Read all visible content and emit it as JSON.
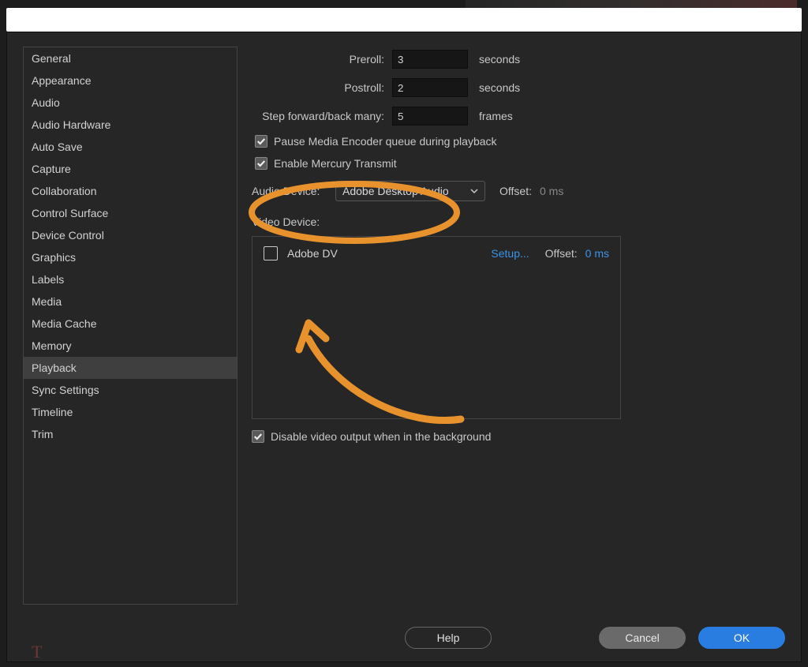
{
  "sidebar": {
    "items": [
      "General",
      "Appearance",
      "Audio",
      "Audio Hardware",
      "Auto Save",
      "Capture",
      "Collaboration",
      "Control Surface",
      "Device Control",
      "Graphics",
      "Labels",
      "Media",
      "Media Cache",
      "Memory",
      "Playback",
      "Sync Settings",
      "Timeline",
      "Trim"
    ],
    "selected_index": 14
  },
  "playback": {
    "preroll": {
      "label": "Preroll:",
      "value": "3",
      "unit": "seconds"
    },
    "postroll": {
      "label": "Postroll:",
      "value": "2",
      "unit": "seconds"
    },
    "step": {
      "label": "Step forward/back many:",
      "value": "5",
      "unit": "frames"
    },
    "pause_me": {
      "checked": true,
      "label": "Pause Media Encoder queue during playback"
    },
    "enable_mercury": {
      "checked": true,
      "label": "Enable Mercury Transmit"
    },
    "audio_device": {
      "label": "Audio Device:",
      "selected": "Adobe Desktop Audio",
      "offset_label": "Offset:",
      "offset_value": "0 ms"
    },
    "video_device": {
      "label": "Video Device:",
      "item": {
        "checked": false,
        "name": "Adobe DV",
        "setup": "Setup...",
        "offset_label": "Offset:",
        "offset_value": "0 ms"
      }
    },
    "disable_bg": {
      "checked": true,
      "label": "Disable video output when in the background"
    }
  },
  "footer": {
    "help": "Help",
    "cancel": "Cancel",
    "ok": "OK"
  },
  "annotations": {
    "circle": "highlight-enable-mercury-transmit",
    "arrow": "arrow-to-adobe-dv-checkbox"
  },
  "colors": {
    "accent": "#2a7de0",
    "link": "#3b93e8",
    "annotation": "#e8922d"
  }
}
